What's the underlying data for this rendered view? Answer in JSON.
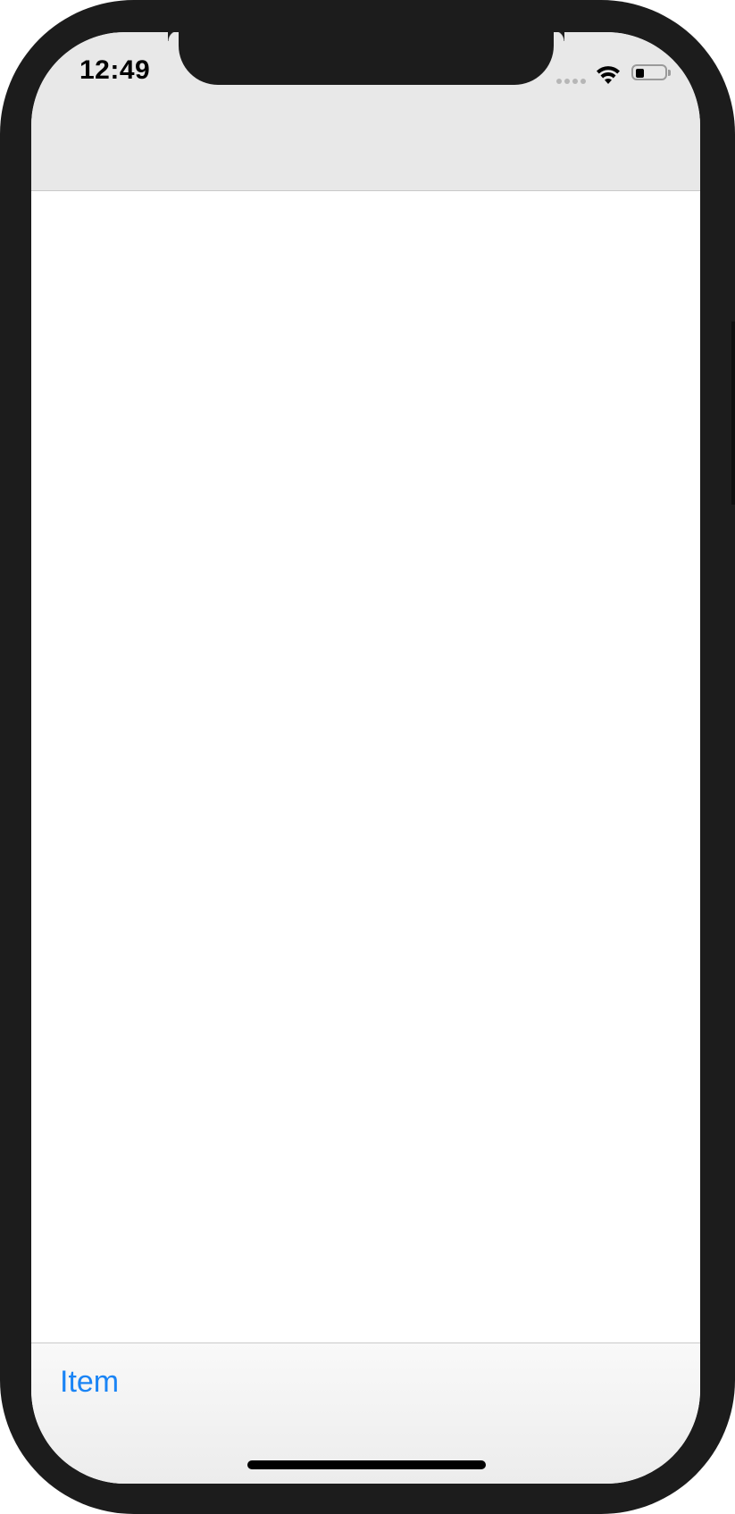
{
  "status_bar": {
    "time": "12:49",
    "signal_icon": "cellular-signal-icon",
    "wifi_icon": "wifi-icon",
    "battery_icon": "battery-icon",
    "battery_level": 0.3
  },
  "toolbar": {
    "item_label": "Item"
  },
  "colors": {
    "accent": "#1a84f5",
    "nav_bar_background": "#e8e8e8",
    "toolbar_background": "#f5f5f5",
    "device_frame": "#1c1c1c"
  }
}
